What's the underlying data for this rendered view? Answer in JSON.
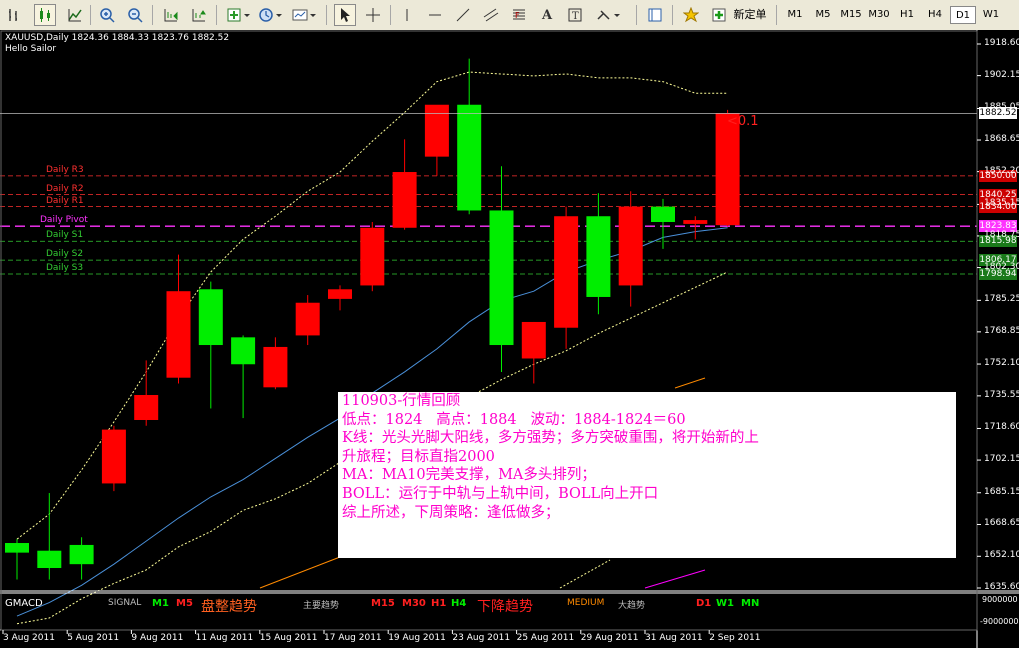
{
  "toolbar": {
    "new_order_label": "新定单",
    "timeframes": [
      "M1",
      "M5",
      "M15",
      "M30",
      "H1",
      "H4",
      "D1",
      "W1"
    ],
    "active_timeframe": "D1"
  },
  "chart_header": {
    "symbol_line": "XAUUSD,Daily  1824.36 1884.33 1823.76 1882.52",
    "ea_name": "Hello Sailor"
  },
  "price_axis": {
    "ticks": [
      "1918.60",
      "1902.15",
      "1885.05",
      "1868.65",
      "1852.20",
      "1835.15",
      "1818.75",
      "1802.30",
      "1785.25",
      "1768.85",
      "1752.10",
      "1735.55",
      "1718.60",
      "1702.15",
      "1685.15",
      "1668.65",
      "1652.10",
      "1635.60"
    ],
    "current_price": "1882.52"
  },
  "pivots": [
    {
      "name": "Daily R3",
      "value": "1850.00",
      "color": "#ff3030"
    },
    {
      "name": "Daily R2",
      "value": "1840.25",
      "color": "#ff3030"
    },
    {
      "name": "Daily R1",
      "value": "1834.00",
      "color": "#ff3030"
    },
    {
      "name": "Daily Pivot",
      "value": "1823.83",
      "color": "#ff33ff"
    },
    {
      "name": "Daily S1",
      "value": "1815.98",
      "color": "#33cc33"
    },
    {
      "name": "Daily S2",
      "value": "1806.17",
      "color": "#33cc33"
    },
    {
      "name": "Daily S3",
      "value": "1798.94",
      "color": "#33cc33"
    }
  ],
  "annotation_small": "<0.1",
  "subwindow": {
    "title": "GMACD",
    "signal_label": "SIGNAL",
    "m1": "M1",
    "m5": "M5",
    "consolidation": "盘整趋势",
    "main_trend": "主要趋势",
    "m15": "M15",
    "m30": "M30",
    "h1": "H1",
    "h4": "H4",
    "downtrend": "下降趋势",
    "medium": "MEDIUM",
    "major_trend": "大趋势",
    "d1": "D1",
    "w1": "W1",
    "mn": "MN",
    "axis_top": "9000000",
    "axis_bottom": "-9000000"
  },
  "time_axis": [
    "3 Aug 2011",
    "5 Aug 2011",
    "9 Aug 2011",
    "11 Aug 2011",
    "15 Aug 2011",
    "17 Aug 2011",
    "19 Aug 2011",
    "23 Aug 2011",
    "25 Aug 2011",
    "29 Aug 2011",
    "31 Aug 2011",
    "2 Sep 2011"
  ],
  "note_lines": [
    "110903-行情回顾",
    "低点：1824   高点：1884   波动：1884-1824＝60",
    "K线：光头光脚大阳线，多方强势；多方突破重围，将开始新的上",
    "升旅程；目标直指2000",
    "MA：MA10完美支撑，MA多头排列；",
    "BOLL：运行于中轨与上轨中间，BOLL向上开口",
    "综上所述，下周策略：逢低做多；"
  ],
  "colors": {
    "bull": "#ff0000",
    "bear": "#00ee00",
    "ma": "#4a90d9",
    "boll": "#ffff99",
    "note_text": "#ff00cc"
  },
  "chart_data": {
    "type": "candlestick",
    "symbol": "XAUUSD",
    "timeframe": "Daily",
    "candles": [
      {
        "o": 1659,
        "h": 1661,
        "l": 1640,
        "c": 1654
      },
      {
        "o": 1655,
        "h": 1685,
        "l": 1640,
        "c": 1646
      },
      {
        "o": 1658,
        "h": 1662,
        "l": 1640,
        "c": 1648
      },
      {
        "o": 1690,
        "h": 1720,
        "l": 1686,
        "c": 1718
      },
      {
        "o": 1723,
        "h": 1754,
        "l": 1720,
        "c": 1736
      },
      {
        "o": 1745,
        "h": 1809,
        "l": 1742,
        "c": 1790
      },
      {
        "o": 1791,
        "h": 1795,
        "l": 1729,
        "c": 1762
      },
      {
        "o": 1766,
        "h": 1767,
        "l": 1724,
        "c": 1752
      },
      {
        "o": 1740,
        "h": 1766,
        "l": 1739,
        "c": 1761
      },
      {
        "o": 1767,
        "h": 1788,
        "l": 1762,
        "c": 1784
      },
      {
        "o": 1786,
        "h": 1793,
        "l": 1780,
        "c": 1791
      },
      {
        "o": 1793,
        "h": 1826,
        "l": 1790,
        "c": 1823
      },
      {
        "o": 1823,
        "h": 1869,
        "l": 1822,
        "c": 1852
      },
      {
        "o": 1860,
        "h": 1886,
        "l": 1850,
        "c": 1887
      },
      {
        "o": 1887,
        "h": 1911,
        "l": 1830,
        "c": 1832
      },
      {
        "o": 1832,
        "h": 1855,
        "l": 1748,
        "c": 1762
      },
      {
        "o": 1755,
        "h": 1774,
        "l": 1742,
        "c": 1774
      },
      {
        "o": 1771,
        "h": 1834,
        "l": 1760,
        "c": 1829
      },
      {
        "o": 1829,
        "h": 1841,
        "l": 1778,
        "c": 1787
      },
      {
        "o": 1793,
        "h": 1842,
        "l": 1782,
        "c": 1834
      },
      {
        "o": 1834,
        "h": 1838,
        "l": 1812,
        "c": 1826
      },
      {
        "o": 1825,
        "h": 1829,
        "l": 1817,
        "c": 1827
      },
      {
        "o": 1824.36,
        "h": 1884.33,
        "l": 1823.76,
        "c": 1882.52
      }
    ],
    "ma10": [
      1621,
      1628,
      1637,
      1648,
      1660,
      1672,
      1683,
      1692,
      1703,
      1714,
      1724,
      1737,
      1748,
      1760,
      1774,
      1785,
      1790,
      1800,
      1806,
      1811,
      1818,
      1821,
      1823
    ],
    "boll_upper": [
      1661,
      1674,
      1697,
      1722,
      1748,
      1776,
      1800,
      1817,
      1829,
      1842,
      1852,
      1868,
      1883,
      1899,
      1904,
      1903,
      1902,
      1903,
      1901,
      1901,
      1899,
      1893,
      1893
    ],
    "boll_lower": [
      1617,
      1620,
      1630,
      1638,
      1645,
      1657,
      1665,
      1676,
      1682,
      1690,
      1701,
      1709,
      1718,
      1725,
      1735,
      1744,
      1752,
      1759,
      1768,
      1776,
      1784,
      1792,
      1800
    ],
    "ylim": [
      1630,
      1925
    ]
  }
}
